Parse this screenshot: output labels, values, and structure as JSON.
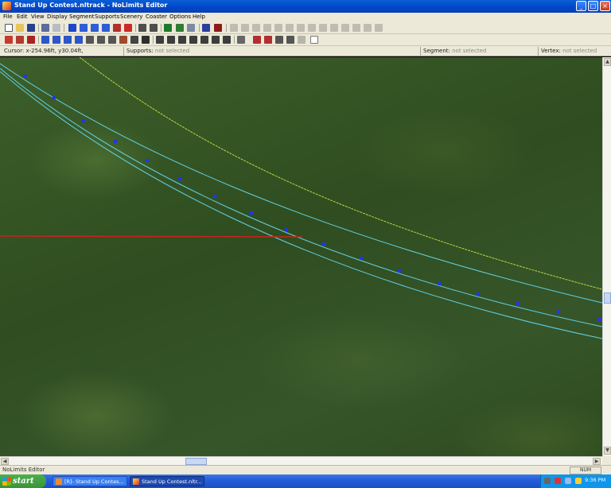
{
  "window": {
    "title": "Stand Up Contest.nltrack - NoLimits Editor",
    "buttons": {
      "minimize": "_",
      "maximize": "□",
      "close": "×"
    }
  },
  "menubar": {
    "items": [
      "File",
      "Edit",
      "View",
      "Display",
      "Segment",
      "Supports",
      "Scenery",
      "Coaster",
      "Options",
      "Help"
    ]
  },
  "infobar": {
    "cursor_label": "Cursor:",
    "cursor_value": "x-254.96ft, y30.04ft,",
    "supports_label": "Supports:",
    "supports_value": "not selected",
    "segment_label": "Segment:",
    "segment_value": "not selected",
    "vertex_label": "Vertex:",
    "vertex_value": "not selected"
  },
  "scroll": {
    "up": "▲",
    "down": "▼",
    "left": "◀",
    "right": "▶",
    "side_arrow": "◄"
  },
  "statusbar": {
    "text": "NoLimits Editor",
    "indicator": "NUM"
  },
  "taskbar": {
    "start_label": "start",
    "tasks": [
      {
        "label": "[R]- Stand Up Contes...",
        "active": false
      },
      {
        "label": "Stand Up Contest.nltr...",
        "active": true
      }
    ],
    "clock": "9:36 PM"
  },
  "colors": {
    "track_rail": "#62d2e6",
    "track_spine": "#bcd640",
    "node": "#2233ff",
    "selection_line": "#c9231c"
  }
}
